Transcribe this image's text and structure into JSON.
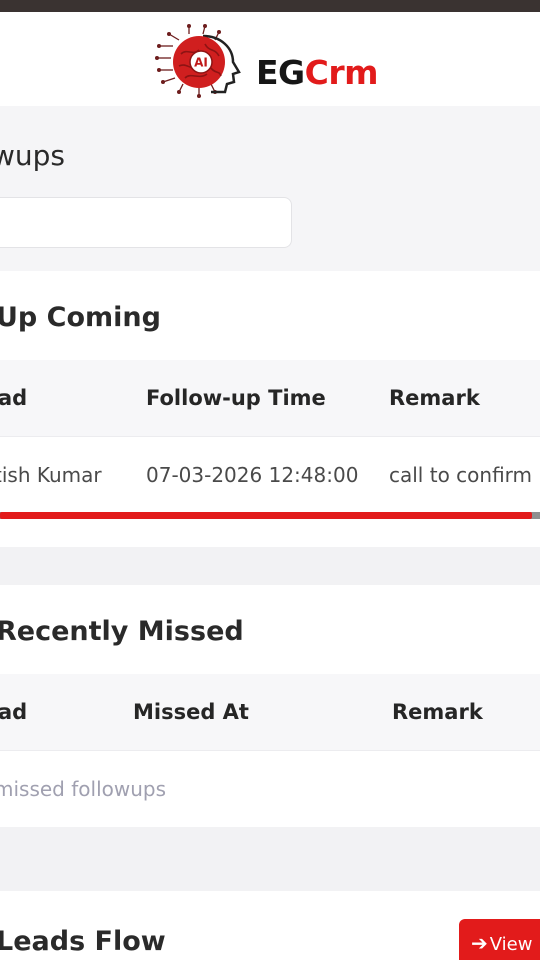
{
  "brand": {
    "name_part1": "EG",
    "name_part2": "Crm",
    "logo_text": "AI"
  },
  "page": {
    "title": "wups"
  },
  "search": {
    "placeholder": ""
  },
  "upcoming": {
    "title": "Up Coming",
    "columns": [
      "ad",
      "Follow-up Time",
      "Remark"
    ],
    "rows": [
      {
        "lead": "tish Kumar",
        "time": "07-03-2026 12:48:00",
        "remark": "call to confirm"
      }
    ]
  },
  "missed": {
    "title": "Recently Missed",
    "columns": [
      "ad",
      "Missed At",
      "Remark"
    ],
    "empty_text": "missed followups"
  },
  "leads_flow": {
    "title": "Leads Flow",
    "view_label": "View",
    "view_icon": "arrow-right-icon"
  },
  "colors": {
    "accent": "#e21b1b",
    "topbar": "#3a3331"
  }
}
